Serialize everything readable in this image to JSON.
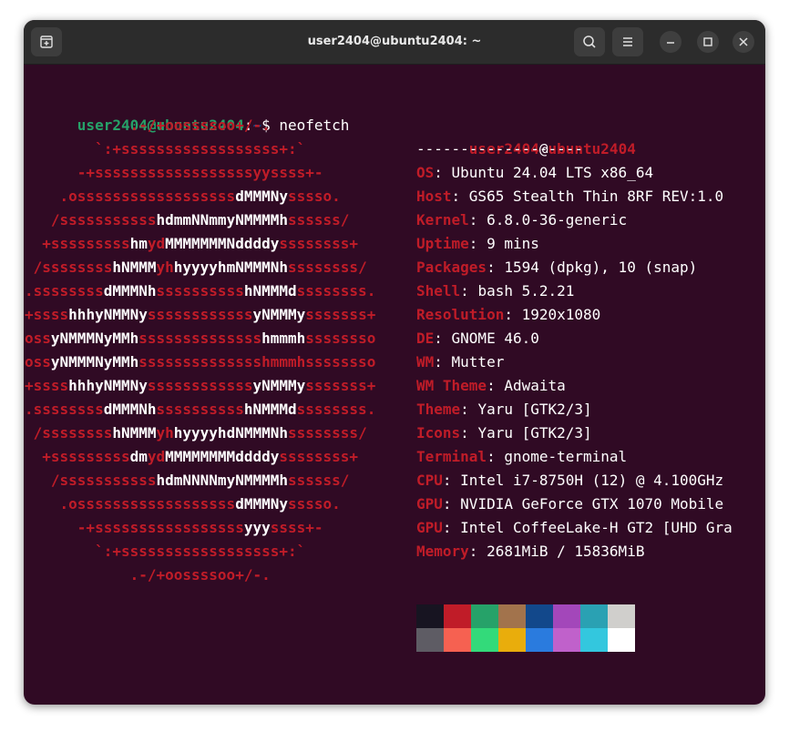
{
  "window": {
    "title": "user2404@ubuntu2404: ~"
  },
  "icons": {
    "new_tab": "new-tab-icon",
    "search": "search-icon",
    "menu": "hamburger-menu-icon",
    "minimize": "minimize-icon",
    "maximize": "maximize-icon",
    "close": "close-icon"
  },
  "prompt": {
    "user": "user2404@ubuntu2404",
    "colon": ":",
    "path": "~",
    "dollar": "$ ",
    "command": "neofetch"
  },
  "logo_lines": [
    [
      [
        "r",
        "            .-/+oossssoo+/-."
      ]
    ],
    [
      [
        "r",
        "        `:+ssssssssssssssssss+:`"
      ]
    ],
    [
      [
        "r",
        "      -+ssssssssssssssssssyyssss+-"
      ]
    ],
    [
      [
        "r",
        "    .ossssssssssssssssss"
      ],
      [
        "w",
        "dMMMNy"
      ],
      [
        "r",
        "sssso."
      ]
    ],
    [
      [
        "r",
        "   /sssssssssss"
      ],
      [
        "w",
        "hdmmNNmmyNMMMMh"
      ],
      [
        "r",
        "ssssss/"
      ]
    ],
    [
      [
        "r",
        "  +sssssssss"
      ],
      [
        "w",
        "hm"
      ],
      [
        "r",
        "yd"
      ],
      [
        "w",
        "MMMMMMMNddddy"
      ],
      [
        "r",
        "ssssssss+"
      ]
    ],
    [
      [
        "r",
        " /ssssssss"
      ],
      [
        "w",
        "hNMMM"
      ],
      [
        "r",
        "yh"
      ],
      [
        "w",
        "hyyyyhmNMMMNh"
      ],
      [
        "r",
        "ssssssss/"
      ]
    ],
    [
      [
        "r",
        ".ssssssss"
      ],
      [
        "w",
        "dMMMNh"
      ],
      [
        "r",
        "ssssssssss"
      ],
      [
        "w",
        "hNMMMd"
      ],
      [
        "r",
        "ssssssss."
      ]
    ],
    [
      [
        "r",
        "+ssss"
      ],
      [
        "w",
        "hhhyNMMNy"
      ],
      [
        "r",
        "ssssssssssss"
      ],
      [
        "w",
        "yNMMMy"
      ],
      [
        "r",
        "sssssss+"
      ]
    ],
    [
      [
        "r",
        "oss"
      ],
      [
        "w",
        "yNMMMNyMMh"
      ],
      [
        "r",
        "ssssssssssssss"
      ],
      [
        "w",
        "hmmmh"
      ],
      [
        "r",
        "ssssssso"
      ]
    ],
    [
      [
        "r",
        "oss"
      ],
      [
        "w",
        "yNMMMNyMMh"
      ],
      [
        "r",
        "sssssssssssssshmmmhssssssso"
      ]
    ],
    [
      [
        "r",
        "+ssss"
      ],
      [
        "w",
        "hhhyNMMNy"
      ],
      [
        "r",
        "ssssssssssss"
      ],
      [
        "w",
        "yNMMMy"
      ],
      [
        "r",
        "sssssss+"
      ]
    ],
    [
      [
        "r",
        ".ssssssss"
      ],
      [
        "w",
        "dMMMNh"
      ],
      [
        "r",
        "ssssssssss"
      ],
      [
        "w",
        "hNMMMd"
      ],
      [
        "r",
        "ssssssss."
      ]
    ],
    [
      [
        "r",
        " /ssssssss"
      ],
      [
        "w",
        "hNMMM"
      ],
      [
        "r",
        "yh"
      ],
      [
        "w",
        "hyyyyhdNMMMNh"
      ],
      [
        "r",
        "ssssssss/"
      ]
    ],
    [
      [
        "r",
        "  +sssssssss"
      ],
      [
        "w",
        "dm"
      ],
      [
        "r",
        "yd"
      ],
      [
        "w",
        "MMMMMMMMddddy"
      ],
      [
        "r",
        "ssssssss+"
      ]
    ],
    [
      [
        "r",
        "   /sssssssssss"
      ],
      [
        "w",
        "hdmNNNNmyNMMMMh"
      ],
      [
        "r",
        "ssssss/"
      ]
    ],
    [
      [
        "r",
        "    .ossssssssssssssssss"
      ],
      [
        "w",
        "dMMMNy"
      ],
      [
        "r",
        "sssso."
      ]
    ],
    [
      [
        "r",
        "      -+sssssssssssssssss"
      ],
      [
        "w",
        "yyy"
      ],
      [
        "r",
        "ssss+-"
      ]
    ],
    [
      [
        "r",
        "        `:+ssssssssssssssssss+:`"
      ]
    ],
    [
      [
        "r",
        "            .-/+oossssoo+/-."
      ]
    ]
  ],
  "info": {
    "user": "user2404",
    "at": "@",
    "host": "ubuntu2404",
    "separator": "-------------------",
    "rows": [
      {
        "label": "OS",
        "value": "Ubuntu 24.04 LTS x86_64"
      },
      {
        "label": "Host",
        "value": "GS65 Stealth Thin 8RF REV:1.0"
      },
      {
        "label": "Kernel",
        "value": "6.8.0-36-generic"
      },
      {
        "label": "Uptime",
        "value": "9 mins"
      },
      {
        "label": "Packages",
        "value": "1594 (dpkg), 10 (snap)"
      },
      {
        "label": "Shell",
        "value": "bash 5.2.21"
      },
      {
        "label": "Resolution",
        "value": "1920x1080"
      },
      {
        "label": "DE",
        "value": "GNOME 46.0"
      },
      {
        "label": "WM",
        "value": "Mutter"
      },
      {
        "label": "WM Theme",
        "value": "Adwaita"
      },
      {
        "label": "Theme",
        "value": "Yaru [GTK2/3]"
      },
      {
        "label": "Icons",
        "value": "Yaru [GTK2/3]"
      },
      {
        "label": "Terminal",
        "value": "gnome-terminal"
      },
      {
        "label": "CPU",
        "value": "Intel i7-8750H (12) @ 4.100GHz"
      },
      {
        "label": "GPU",
        "value": "NVIDIA GeForce GTX 1070 Mobile"
      },
      {
        "label": "GPU",
        "value": "Intel CoffeeLake-H GT2 [UHD Gra"
      },
      {
        "label": "Memory",
        "value": "2681MiB / 15836MiB"
      }
    ],
    "label_sep": ": "
  },
  "palette": {
    "normal": [
      "#171421",
      "#c01c28",
      "#26a269",
      "#a2734c",
      "#12488b",
      "#a347ba",
      "#2aa1b3",
      "#d0cfcc"
    ],
    "bright": [
      "#5e5c64",
      "#f66151",
      "#33da7a",
      "#e9ad0c",
      "#2a7bde",
      "#c061cb",
      "#33c7de",
      "#ffffff"
    ]
  }
}
